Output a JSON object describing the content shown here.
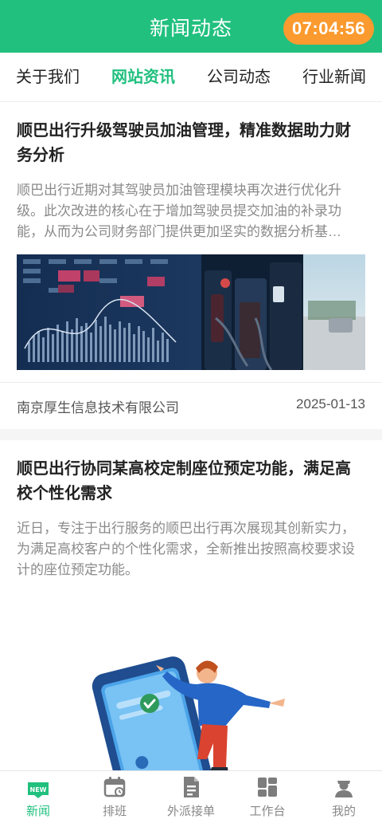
{
  "header": {
    "title": "新闻动态",
    "timer": "07:04:56"
  },
  "tabs": [
    {
      "label": "关于我们"
    },
    {
      "label": "网站资讯",
      "active": true
    },
    {
      "label": "公司动态"
    },
    {
      "label": "行业新闻"
    }
  ],
  "articles": [
    {
      "title": "顺巴出行升级驾驶员加油管理，精准数据助力财务分析",
      "summary": "顺巴出行近期对其驾驶员加油管理模块再次进行优化升级。此次改进的核心在于增加驾驶员提交加油的补录功能，从而为公司财务部门提供更加坚实的数据分析基…",
      "source": "南京厚生信息技术有限公司",
      "date": "2025-01-13",
      "image": "fuel-station-data-dashboard"
    },
    {
      "title": "顺巴出行协同某高校定制座位预定功能，满足高校个性化需求",
      "summary": "近日，专注于出行服务的顺巴出行再次展现其创新实力，为满足高校客户的个性化需求，全新推出按照高校要求设计的座位预定功能。",
      "image": "phone-booking-illustration"
    }
  ],
  "tabbar": {
    "items": [
      {
        "label": "新闻",
        "icon": "news-icon",
        "active": true
      },
      {
        "label": "排班",
        "icon": "calendar-icon"
      },
      {
        "label": "外派接单",
        "icon": "document-icon"
      },
      {
        "label": "工作台",
        "icon": "dashboard-icon"
      },
      {
        "label": "我的",
        "icon": "user-icon"
      }
    ],
    "badge": "NEW"
  },
  "colors": {
    "primary": "#21c07f",
    "timer": "#fb9a2e",
    "text": "#222222",
    "muted": "#8a8a8a"
  }
}
